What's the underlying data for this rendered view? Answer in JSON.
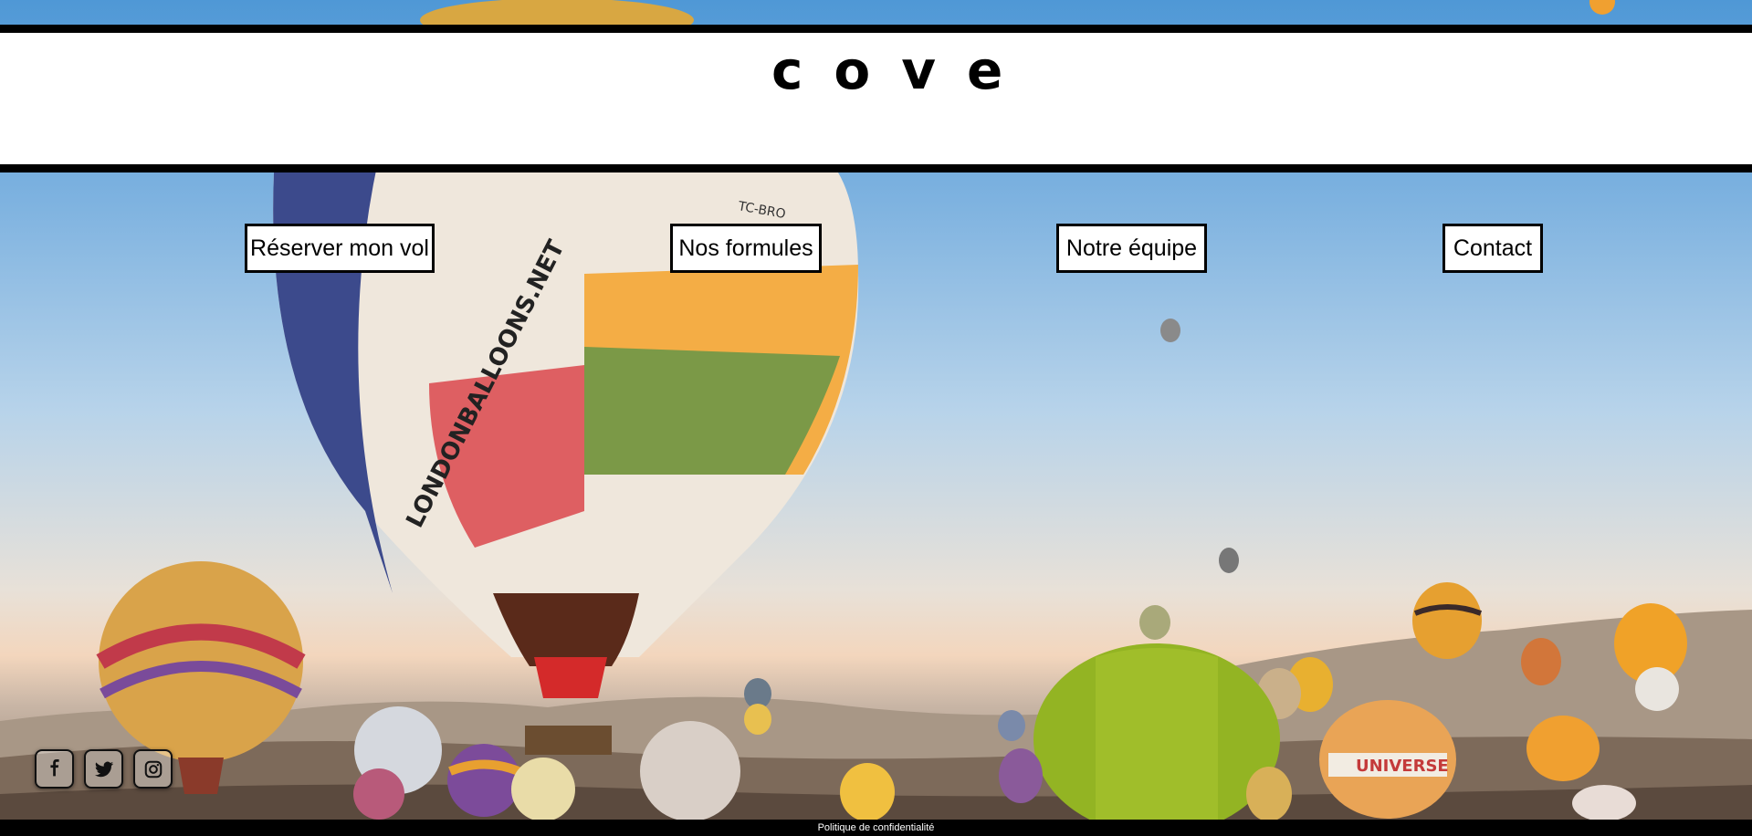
{
  "header": {
    "logo_text": "cove"
  },
  "nav": {
    "items": [
      {
        "label": "Réserver mon vol"
      },
      {
        "label": "Nos formules"
      },
      {
        "label": "Notre équipe"
      },
      {
        "label": "Contact"
      }
    ]
  },
  "hero": {
    "balloon_text": "LONDONBALLOONS.NET",
    "balloon_registration": "TC-BRO",
    "balloon_brand": "UNIVERSE"
  },
  "social": {
    "items": [
      {
        "icon": "facebook-icon"
      },
      {
        "icon": "twitter-icon"
      },
      {
        "icon": "instagram-icon"
      }
    ]
  },
  "footer": {
    "privacy_link": "Politique de confidentialité"
  },
  "colors": {
    "header_bg": "#ffffff",
    "border": "#000000",
    "sky_top": "#4f98d6",
    "footer_bg": "#000000"
  }
}
